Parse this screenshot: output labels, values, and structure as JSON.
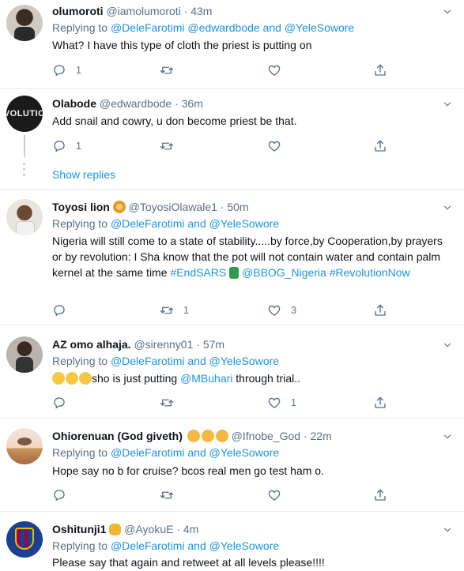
{
  "tweets": [
    {
      "name": "olumoroti",
      "handle": "@iamolumoroti · 43m",
      "reply_prefix": "Replying to",
      "reply_to": "@DeleFarotimi @edwardbode and @YeleSowore",
      "text": "What? I have this type of cloth the priest is putting on",
      "reply_count": "1",
      "retweet_count": "",
      "like_count": ""
    },
    {
      "name": "Olabode",
      "handle": "@edwardbode · 36m",
      "text": "Add snail and cowry, u don become priest be that.",
      "reply_count": "1",
      "retweet_count": "",
      "like_count": "",
      "avatar_text": "VOLUTIO"
    },
    {
      "name": "Toyosi lion",
      "handle": "@ToyosiOlawale1 · 50m",
      "reply_prefix": "Replying to",
      "reply_to": "@DeleFarotimi and @YeleSowore",
      "text_a": "Nigeria will still come to a state of stability.....by force,by Cooperation,by prayers or by revolution: I Sha know that the pot will not contain water and contain palm kernel at the same time ",
      "hashtag1": "#EndSARS",
      "mention1": " @BBOG_Nigeria",
      "hashtag2": "#RevolutionNow",
      "reply_count": "",
      "retweet_count": "1",
      "like_count": "3"
    },
    {
      "name": "AZ omo alhaja.",
      "handle": "@sirenny01 · 57m",
      "reply_prefix": "Replying to",
      "reply_to": "@DeleFarotimi and @YeleSowore",
      "text_a": "sho is just putting ",
      "mention1": "@MBuhari",
      "text_b": " through trial..",
      "reply_count": "",
      "retweet_count": "",
      "like_count": "1"
    },
    {
      "name": "Ohiorenuan (God giveth)",
      "handle": "@Ifnobe_God · 22m",
      "reply_prefix": "Replying to",
      "reply_to": "@DeleFarotimi and @YeleSowore",
      "text": "Hope say no b for cruise? bcos real men go test ham o.",
      "reply_count": "",
      "retweet_count": "",
      "like_count": ""
    },
    {
      "name": "Oshitunji1",
      "handle": "@AyokuE · 4m",
      "reply_prefix": "Replying to",
      "reply_to": "@DeleFarotimi and @YeleSowore",
      "text": "Please say that again and retweet at all levels please!!!!"
    }
  ],
  "show_replies": "Show replies",
  "colors": {
    "link": "#1b95e0",
    "muted": "#5b7083",
    "border": "#e6ecf0"
  }
}
